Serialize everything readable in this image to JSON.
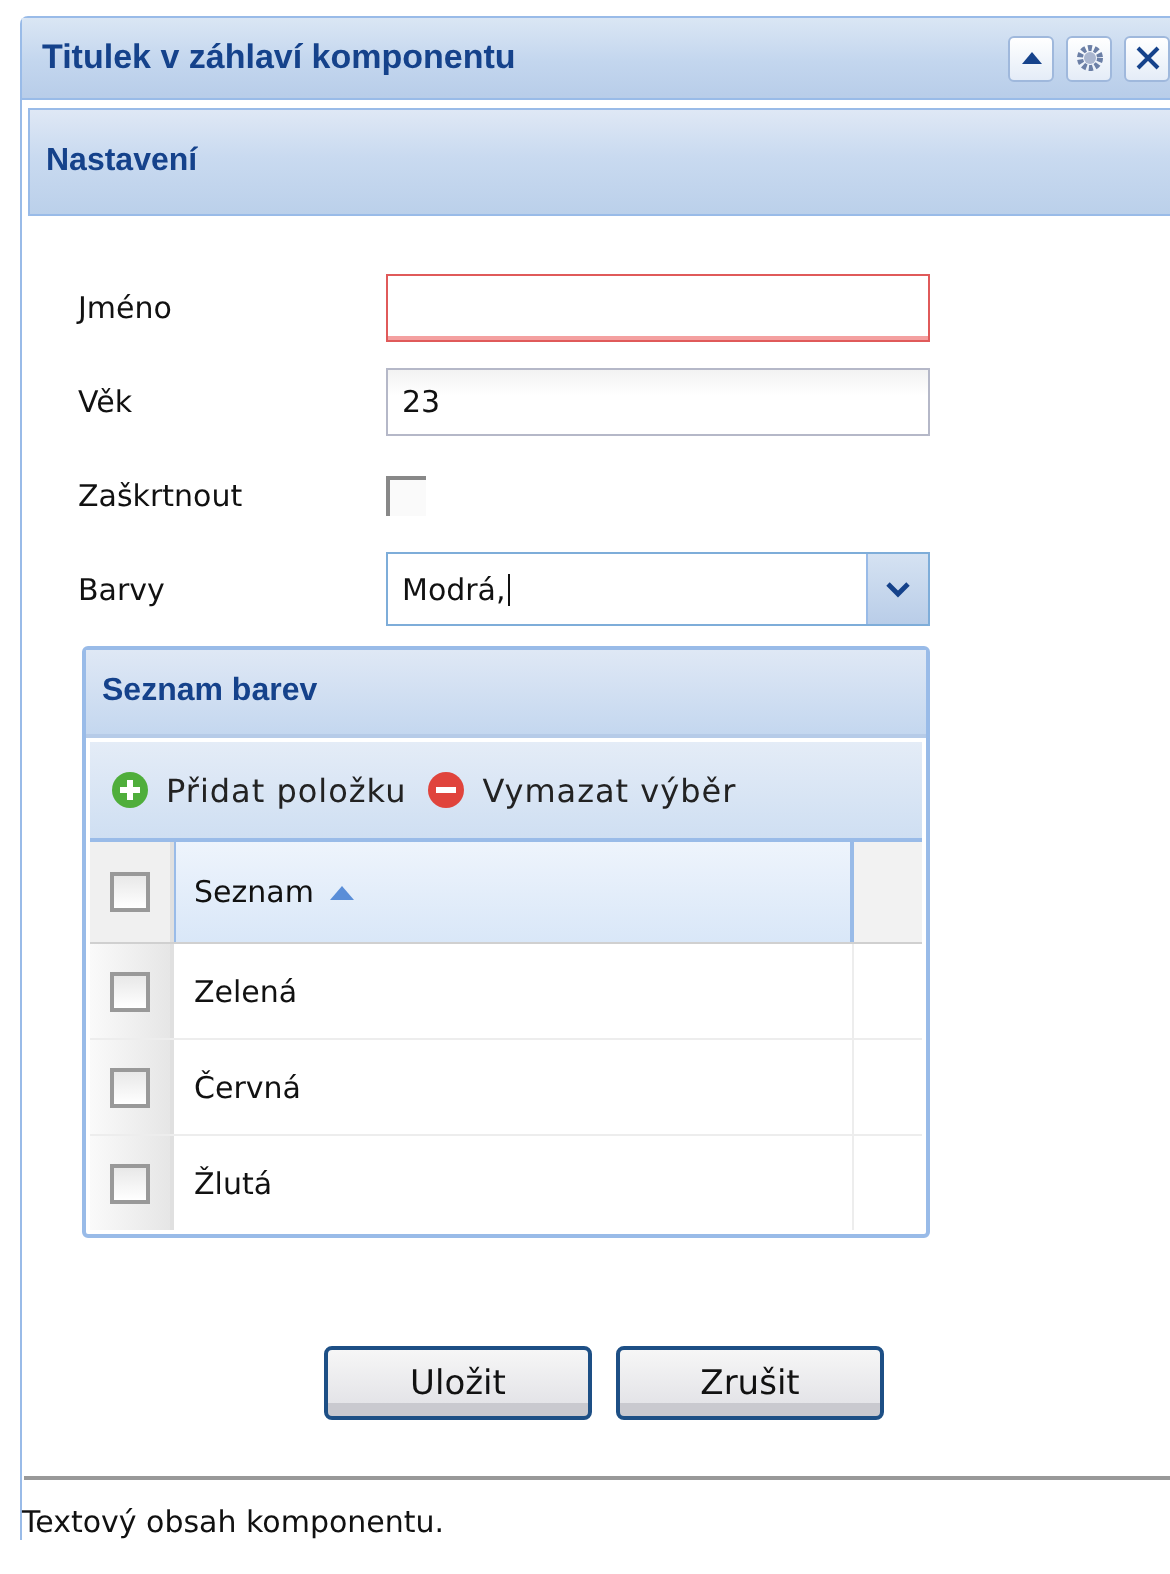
{
  "window": {
    "title": "Titulek v záhlaví komponentu"
  },
  "settings": {
    "title": "Nastavení"
  },
  "fields": [
    {
      "kind": "text",
      "label": "Jméno",
      "invalid": true
    },
    {
      "kind": "text",
      "label": "Věk",
      "value": "23",
      "invalid": false
    },
    {
      "kind": "checkbox",
      "label": "Zaškrtnout",
      "checked": false
    },
    {
      "kind": "combo",
      "label": "Barvy",
      "value": "Modrá,"
    }
  ],
  "grid": {
    "title": "Seznam barev",
    "toolbar": [
      {
        "kind": "add",
        "label": "Přidat položku"
      },
      {
        "kind": "remove",
        "label": "Vymazat výběr"
      }
    ],
    "header": {
      "label": "Seznam",
      "sort_ascending": true,
      "checked": false
    },
    "rows": [
      {
        "label": "Zelená",
        "checked": false
      },
      {
        "label": "Červná",
        "checked": false
      },
      {
        "label": "Žlutá",
        "checked": false
      }
    ]
  },
  "buttons": [
    "Uložit",
    "Zrušit"
  ],
  "content": "Textový obsah komponentu."
}
